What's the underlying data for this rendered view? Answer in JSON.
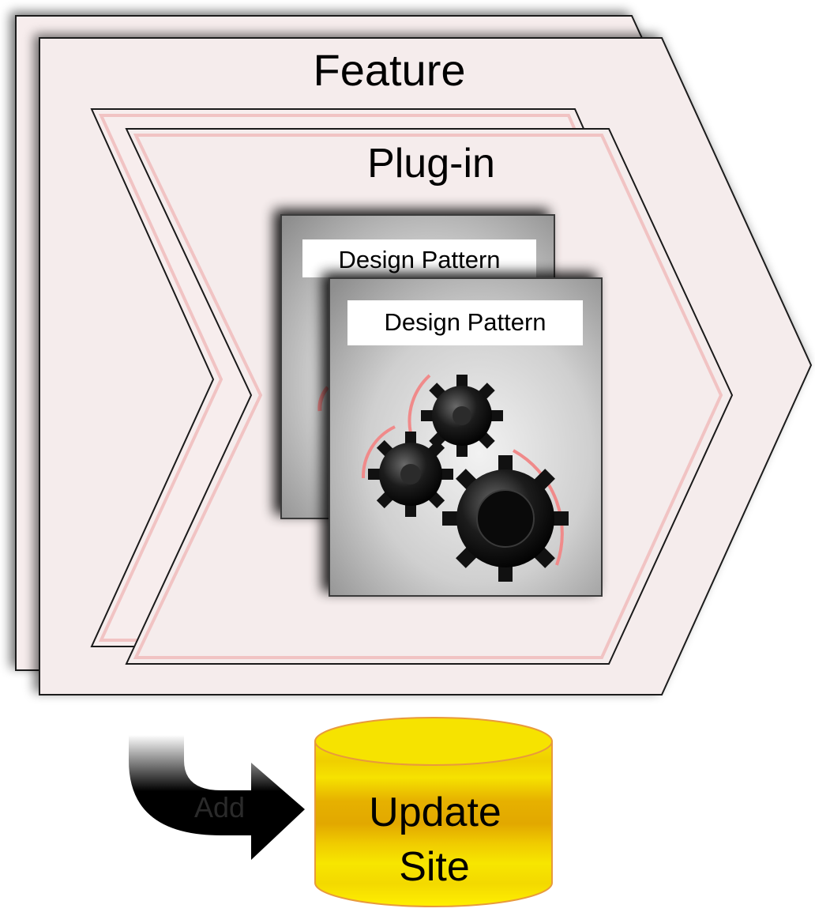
{
  "diagram": {
    "feature_label": "Feature",
    "plugin_label": "Plug-in",
    "pattern_back_label": "Design Pattern",
    "pattern_front_label": "Design Pattern",
    "add_label": "Add",
    "update_site_line1": "Update",
    "update_site_line2": "Site"
  },
  "colors": {
    "chevron_fill": "#f5ecec",
    "chevron_inner_edge": "#f1c3c3",
    "cylinder_fill": "#f2d200",
    "cylinder_band": "#e8b400",
    "cylinder_stroke": "#e89a3c",
    "arc_color": "#f08a8a"
  },
  "icons": [
    "gears-icon",
    "curved-arrow-icon",
    "database-cylinder-icon"
  ]
}
